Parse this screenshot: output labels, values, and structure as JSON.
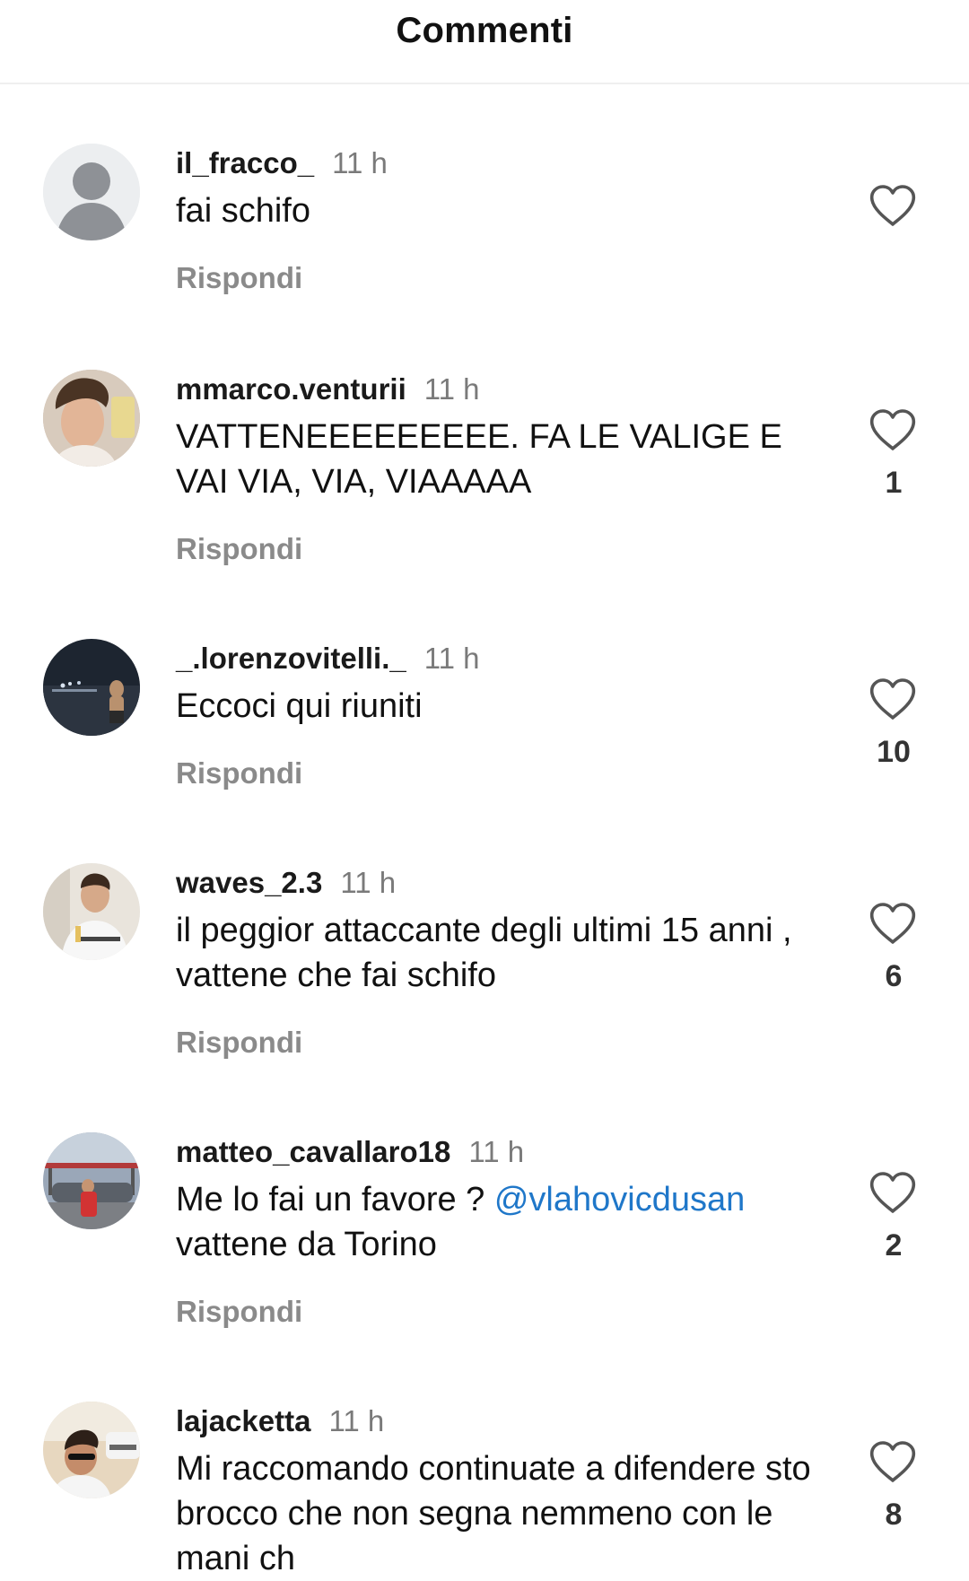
{
  "header": {
    "title": "Commenti"
  },
  "comments": [
    {
      "username": "il_fracco_",
      "time": "11 h",
      "text": "fai schifo",
      "reply": "Rispondi",
      "likes": "",
      "avatar": "default-avatar-icon"
    },
    {
      "username": "mmarco.venturii",
      "time": "11 h",
      "text": "VATTENEEEEEEEEE. FA LE VALIGE E VAI VIA, VIA, VIAAAAA",
      "reply": "Rispondi",
      "likes": "1",
      "avatar": "profile-photo"
    },
    {
      "username": "_.lorenzovitelli._",
      "time": "11 h",
      "text": "Eccoci qui riuniti",
      "reply": "Rispondi",
      "likes": "10",
      "avatar": "profile-photo"
    },
    {
      "username": "waves_2.3",
      "time": "11 h",
      "text": "il peggior attaccante degli ultimi 15 anni , vattene che fai schifo",
      "reply": "Rispondi",
      "likes": "6",
      "avatar": "profile-photo"
    },
    {
      "username": "matteo_cavallaro18",
      "time": "11 h",
      "text_before": "Me lo fai un favore ? ",
      "mention": "@vlahovicdusan",
      "text_after": " vattene da Torino",
      "reply": "Rispondi",
      "likes": "2",
      "avatar": "profile-photo"
    },
    {
      "username": "lajacketta",
      "time": "11 h",
      "text": "Mi raccomando continuate a difendere sto brocco che non segna nemmeno con le mani ch",
      "reply": "Rispondi",
      "likes": "8",
      "avatar": "profile-photo"
    }
  ],
  "colors": {
    "mention": "#1f77c9",
    "secondary_text": "#7a7a7a",
    "reply_text": "#8a8a8a"
  }
}
